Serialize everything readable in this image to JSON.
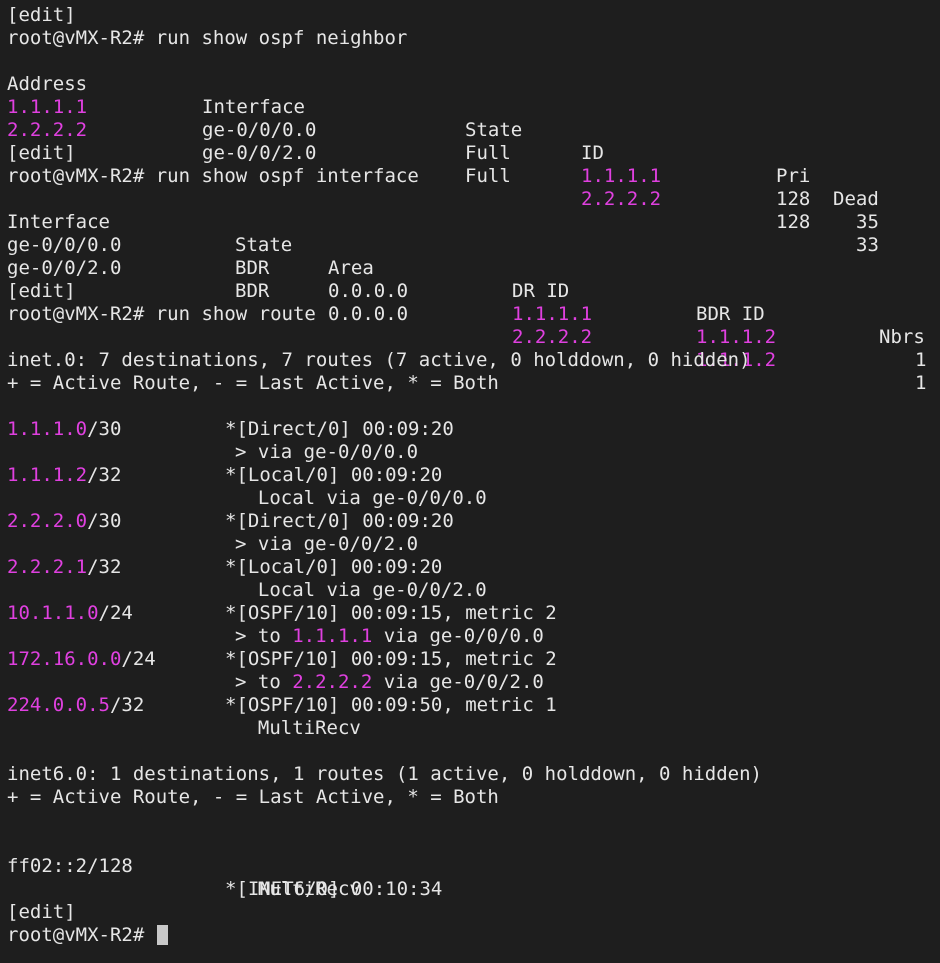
{
  "blocks": {
    "edit1": "[edit]",
    "prompt1": "root@vMX-R2# run show ospf neighbor",
    "nbr_header": {
      "address": "Address",
      "interface": "Interface",
      "state": "State",
      "id": "ID",
      "pri": "Pri",
      "dead": "Dead"
    },
    "nbr_rows": [
      {
        "address": "1.1.1.1",
        "interface": "ge-0/0/0.0",
        "state": "Full",
        "id": "1.1.1.1",
        "pri": "128",
        "dead": "35"
      },
      {
        "address": "2.2.2.2",
        "interface": "ge-0/0/2.0",
        "state": "Full",
        "id": "2.2.2.2",
        "pri": "128",
        "dead": "33"
      }
    ],
    "edit2": "[edit]",
    "prompt2": "root@vMX-R2# run show ospf interface",
    "if_header": {
      "interface": "Interface",
      "state": "State",
      "area": "Area",
      "dr": "DR ID",
      "bdr": "BDR ID",
      "nbrs": "Nbrs"
    },
    "if_rows": [
      {
        "interface": "ge-0/0/0.0",
        "state": "BDR",
        "area": "0.0.0.0",
        "dr": "1.1.1.1",
        "bdr": "1.1.1.2",
        "nbrs": "1"
      },
      {
        "interface": "ge-0/0/2.0",
        "state": "BDR",
        "area": "0.0.0.0",
        "dr": "2.2.2.2",
        "bdr": "1.1.1.2",
        "nbrs": "1"
      }
    ],
    "edit3": "[edit]",
    "prompt3": "root@vMX-R2# run show route",
    "inet0_summary": "inet.0: 7 destinations, 7 routes (7 active, 0 holddown, 0 hidden)",
    "legend1": "+ = Active Route, - = Last Active, * = Both",
    "routes": [
      {
        "prefix": "1.1.1.0",
        "len": "/30",
        "proto": "*[Direct/0] 00:09:20",
        "next": "> via ge-0/0/0.0",
        "next_pre": "",
        "next_hl": "",
        "next_post": ""
      },
      {
        "prefix": "1.1.1.2",
        "len": "/32",
        "proto": "*[Local/0] 00:09:20",
        "next": "  Local via ge-0/0/0.0",
        "next_pre": "",
        "next_hl": "",
        "next_post": ""
      },
      {
        "prefix": "2.2.2.0",
        "len": "/30",
        "proto": "*[Direct/0] 00:09:20",
        "next": "> via ge-0/0/2.0",
        "next_pre": "",
        "next_hl": "",
        "next_post": ""
      },
      {
        "prefix": "2.2.2.1",
        "len": "/32",
        "proto": "*[Local/0] 00:09:20",
        "next": "  Local via ge-0/0/2.0",
        "next_pre": "",
        "next_hl": "",
        "next_post": ""
      },
      {
        "prefix": "10.1.1.0",
        "len": "/24",
        "proto": "*[OSPF/10] 00:09:15, metric 2",
        "next": "",
        "next_pre": "> to ",
        "next_hl": "1.1.1.1",
        "next_post": " via ge-0/0/0.0"
      },
      {
        "prefix": "172.16.0.0",
        "len": "/24",
        "proto": "*[OSPF/10] 00:09:15, metric 2",
        "next": "",
        "next_pre": "> to ",
        "next_hl": "2.2.2.2",
        "next_post": " via ge-0/0/2.0"
      },
      {
        "prefix": "224.0.0.5",
        "len": "/32",
        "proto": "*[OSPF/10] 00:09:50, metric 1",
        "next": "  MultiRecv",
        "next_pre": "",
        "next_hl": "",
        "next_post": ""
      }
    ],
    "inet6_summary": "inet6.0: 1 destinations, 1 routes (1 active, 0 holddown, 0 hidden)",
    "legend2": "+ = Active Route, - = Last Active, * = Both",
    "route6": {
      "prefix": "ff02::2/128",
      "proto": "*[INET6/0] 00:10:34",
      "next": "  MultiRecv"
    },
    "edit4": "[edit]",
    "prompt4": "root@vMX-R2# "
  },
  "colors": {
    "background": "#1e1e1e",
    "text": "#e6e6e6",
    "highlight": "#e040e0",
    "cursor": "#c8c8c8"
  }
}
